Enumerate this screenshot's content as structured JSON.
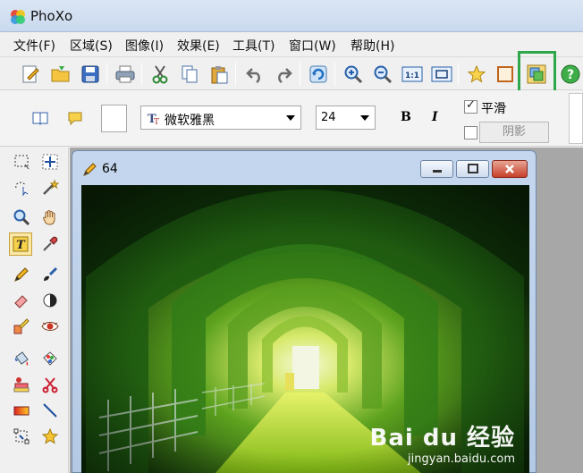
{
  "window": {
    "title": "PhoXo"
  },
  "menu": [
    "文件(F)",
    "区域(S)",
    "图像(I)",
    "效果(E)",
    "工具(T)",
    "窗口(W)",
    "帮助(H)"
  ],
  "toolbar": {
    "buttons": [
      "new-icon",
      "open-folder-icon",
      "save-icon",
      "print-icon",
      "cut-icon",
      "copy-icon",
      "paste-icon",
      "undo-icon",
      "redo-icon",
      "refresh-icon",
      "zoom-in-icon",
      "zoom-out-icon",
      "actual-size-icon",
      "fit-window-icon",
      "star-icon",
      "rectangle-icon",
      "layer-icon",
      "help-icon"
    ],
    "actual_size_label": "1:1",
    "highlight_color": "#2ea84a"
  },
  "text_options": {
    "font": "微软雅黑",
    "size": "24",
    "bold_label": "B",
    "italic_label": "I",
    "smooth_label": "平滑",
    "smooth_checked": true,
    "shadow_label": "阴影",
    "shadow_checked": false,
    "color": "#ffffff"
  },
  "document": {
    "title": "64"
  },
  "watermark": {
    "main": "Bai du 经验",
    "sub": "jingyan.baidu.com"
  }
}
